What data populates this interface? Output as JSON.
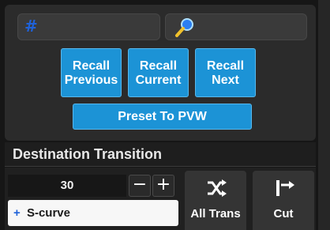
{
  "top": {
    "number_field": {
      "symbol": "#"
    },
    "search_field": {
      "icon": "magnifier-icon"
    }
  },
  "buttons": {
    "recall_previous": {
      "line1": "Recall",
      "line2": "Previous"
    },
    "recall_current": {
      "line1": "Recall",
      "line2": "Current"
    },
    "recall_next": {
      "line1": "Recall",
      "line2": "Next"
    },
    "preset_to_pvw": "Preset To PVW"
  },
  "transition": {
    "header": "Destination Transition",
    "duration": "30",
    "minus": "−",
    "plus": "+",
    "curve_prefix": "+",
    "curve": "S-curve",
    "all_trans_label": "All Trans",
    "cut_label": "Cut"
  },
  "colors": {
    "accent_blue": "#1c93d6",
    "hash_blue": "#1f62d9"
  }
}
